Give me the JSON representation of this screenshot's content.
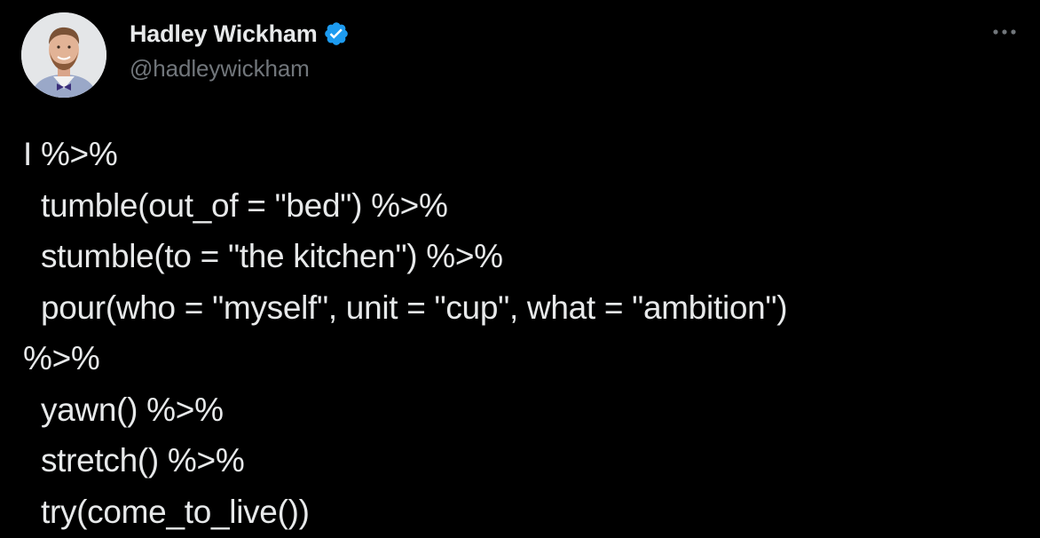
{
  "author": {
    "display_name": "Hadley Wickham",
    "handle": "@hadleywickham",
    "verified": true,
    "avatar_icon": "profile-photo"
  },
  "actions": {
    "more_icon": "more-horizontal-icon"
  },
  "tweet": {
    "lines": [
      "I %>%",
      "  tumble(out_of = \"bed\") %>%",
      "  stumble(to = \"the kitchen\") %>%",
      "  pour(who = \"myself\", unit = \"cup\", what = \"ambition\")",
      "%>%",
      "  yawn() %>%",
      "  stretch() %>%",
      "  try(come_to_live())"
    ]
  },
  "colors": {
    "background": "#000000",
    "text_primary": "#e7e9ea",
    "text_secondary": "#71767b",
    "verified_badge": "#1d9bf0"
  }
}
